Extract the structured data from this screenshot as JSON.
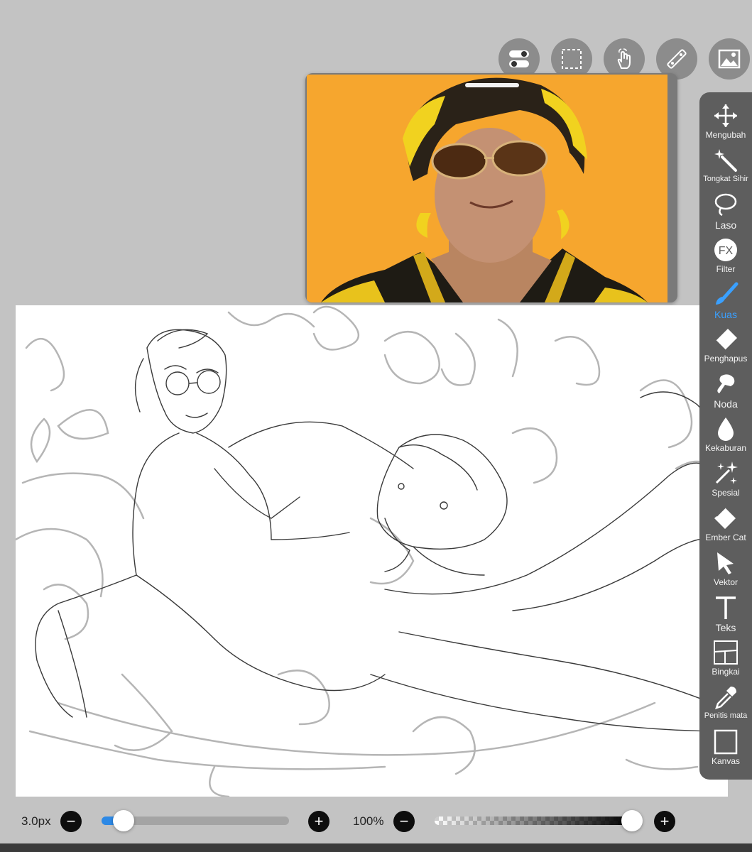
{
  "top_actions": [
    {
      "name": "layer-toggle-button",
      "icon": "toggle-icon"
    },
    {
      "name": "selection-button",
      "icon": "selection-icon"
    },
    {
      "name": "hand-tool-button",
      "icon": "hand-icon"
    },
    {
      "name": "ruler-button",
      "icon": "ruler-icon"
    },
    {
      "name": "reference-image-button",
      "icon": "image-icon"
    }
  ],
  "tools": [
    {
      "label": "Mengubah",
      "icon": "move-icon"
    },
    {
      "label": "Tongkat Sihir",
      "icon": "magic-wand-icon"
    },
    {
      "label": "Laso",
      "icon": "lasso-icon"
    },
    {
      "label": "Filter",
      "icon": "fx-icon"
    },
    {
      "label": "Kuas",
      "icon": "brush-icon",
      "active": true
    },
    {
      "label": "Penghapus",
      "icon": "eraser-icon"
    },
    {
      "label": "Noda",
      "icon": "smudge-icon"
    },
    {
      "label": "Kekaburan",
      "icon": "blur-icon"
    },
    {
      "label": "Spesial",
      "icon": "special-icon"
    },
    {
      "label": "Ember Cat",
      "icon": "bucket-icon"
    },
    {
      "label": "Vektor",
      "icon": "vector-icon"
    },
    {
      "label": "Teks",
      "icon": "text-icon"
    },
    {
      "label": "Bingkai",
      "icon": "frame-icon"
    },
    {
      "label": "Penitis mata",
      "icon": "eyedropper-icon"
    },
    {
      "label": "Kanvas",
      "icon": "canvas-icon"
    }
  ],
  "brush": {
    "size_label": "3.0px",
    "size_fraction": 0.07,
    "opacity_label": "100%",
    "opacity_fraction": 1.0
  },
  "colors": {
    "accent": "#3aa0ff",
    "reference_background": "#f6a62e",
    "toolbar": "#5e5e5e"
  }
}
